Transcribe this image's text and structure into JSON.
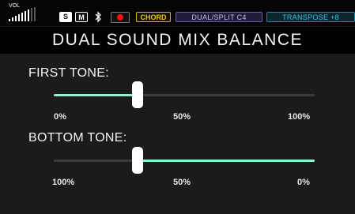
{
  "status_bar": {
    "volume_label": "VOL",
    "mode_s": "S",
    "mode_m": "M",
    "chord_label": "CHORD",
    "dual_split_label": "DUAL/SPLIT C4",
    "transpose_label": "TRANSPOSE +8"
  },
  "title": "DUAL SOUND MIX BALANCE",
  "first_tone": {
    "label": "FIRST TONE:",
    "level_percent": 32,
    "min_label": "0%",
    "mid_label": "50%",
    "max_label": "100%"
  },
  "bottom_tone": {
    "label": "BOTTOM TONE:",
    "level_percent": 32,
    "min_label": "100%",
    "mid_label": "50%",
    "max_label": "0%"
  },
  "colors": {
    "accent": "#8ff2d2",
    "chord": "#f0c800",
    "dual_split": "#6a5ba3",
    "transpose": "#38c4e0",
    "record": "#ff1010"
  }
}
